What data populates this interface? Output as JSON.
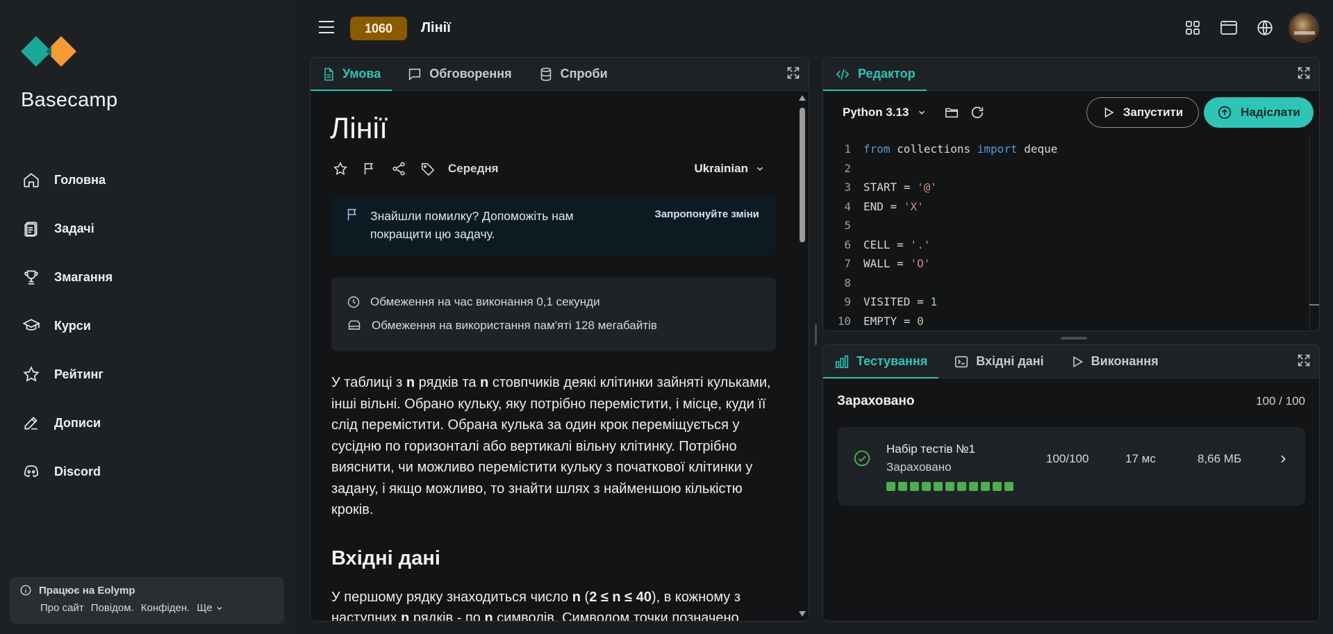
{
  "sidebar": {
    "brand": "Basecamp",
    "items": [
      {
        "label": "Головна",
        "icon": "home-icon"
      },
      {
        "label": "Задачі",
        "icon": "clipboard-icon"
      },
      {
        "label": "Змагання",
        "icon": "trophy-icon"
      },
      {
        "label": "Курси",
        "icon": "graduation-cap-icon"
      },
      {
        "label": "Рейтинг",
        "icon": "star-icon"
      },
      {
        "label": "Дописи",
        "icon": "edit-icon"
      },
      {
        "label": "Discord",
        "icon": "discord-icon"
      }
    ],
    "footer": {
      "title": "Працює на Eolymp",
      "links": [
        "Про сайт",
        "Повідом.",
        "Конфіден.",
        "Ще"
      ]
    }
  },
  "topbar": {
    "problem_id": "1060",
    "title": "Лінії"
  },
  "problem_panel": {
    "tabs": [
      "Умова",
      "Обговорення",
      "Спроби"
    ],
    "title": "Лінії",
    "difficulty": "Середня",
    "language": "Ukrainian",
    "notice_text": "Знайшли помилку? Допоможіть нам покращити цю задачу.",
    "notice_link": "Запропонуйте зміни",
    "time_limit": "Обмеження на час виконання 0,1 секунди",
    "memory_limit": "Обмеження на використання пам'яті 128 мегабайтів",
    "statement": {
      "p1": "У таблиці з ",
      "n1": "n",
      "p2": " рядків та ",
      "n2": "n",
      "p3": " стовпчиків деякі клітинки зайняті кульками, інші вільні. Обрано кульку, яку потрібно перемістити, і місце, куди її слід перемістити. Обрана кулька за один крок переміщується у сусідню по горизонталі або вертикалі вільну клітинку. Потрібно вияснити, чи можливо перемістити кульку з початкової клітинки у задану, і якщо можливо, то знайти шлях з найменшою кількістю кроків."
    },
    "input_heading": "Вхідні дані",
    "input_text": {
      "p1": "У першому рядку знаходиться число ",
      "b1": "n",
      "p2": " (",
      "b2": "2 ≤ n ≤ 40",
      "p3": "), в кожному з наступних ",
      "b3": "n",
      "p4": " рядків - по ",
      "b4": "n",
      "p5": " символів. Символом точки позначено"
    }
  },
  "editor_panel": {
    "tab": "Редактор",
    "python_version": "Python 3.13",
    "run_label": "Запустити",
    "submit_label": "Надіслати",
    "code_lines": [
      {
        "n": "1",
        "text": "from collections import deque"
      },
      {
        "n": "2",
        "text": ""
      },
      {
        "n": "3",
        "text": "START = '@'"
      },
      {
        "n": "4",
        "text": "END = 'X'"
      },
      {
        "n": "5",
        "text": ""
      },
      {
        "n": "6",
        "text": "CELL = '.'"
      },
      {
        "n": "7",
        "text": "WALL = 'O'"
      },
      {
        "n": "8",
        "text": ""
      },
      {
        "n": "9",
        "text": "VISITED = 1"
      },
      {
        "n": "10",
        "text": "EMPTY = 0"
      }
    ]
  },
  "testing_panel": {
    "tabs": [
      "Тестування",
      "Вхідні дані",
      "Виконання"
    ],
    "result_title": "Зараховано",
    "result_score": "100 / 100",
    "test_set": {
      "name": "Набір тестів №1",
      "status": "Зараховано",
      "score": "100/100",
      "time": "17 мс",
      "memory": "8,66 МБ",
      "passed_tests": 11
    }
  },
  "colors": {
    "accent": "#2ec4b6",
    "badge": "#8a5a00",
    "pass": "#4caf50"
  }
}
